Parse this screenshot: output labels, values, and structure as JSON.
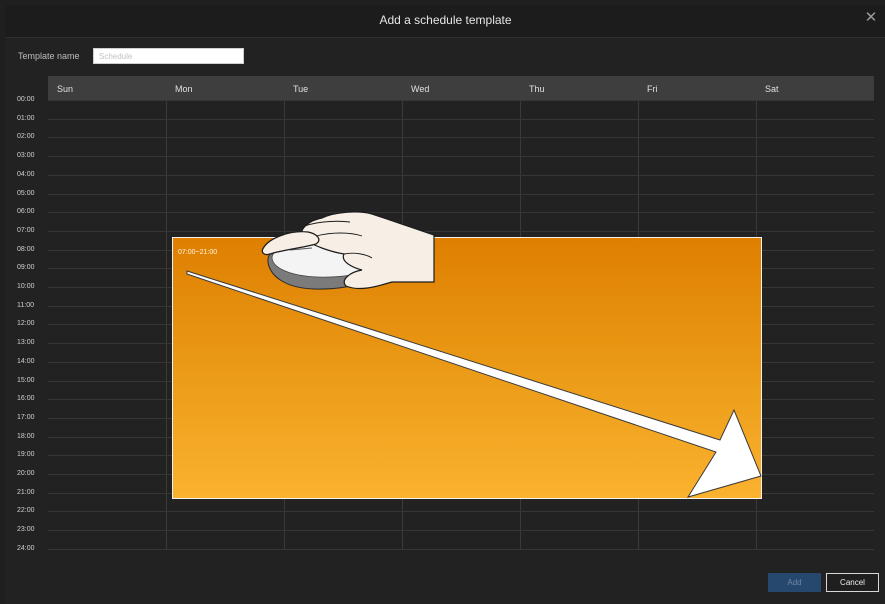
{
  "dialog": {
    "title": "Add a schedule template",
    "close_glyph": "✕",
    "close_icon": "close-icon"
  },
  "template": {
    "label": "Template name",
    "value": "",
    "placeholder": "Schedule"
  },
  "days": [
    "Sun",
    "Mon",
    "Tue",
    "Wed",
    "Thu",
    "Fri",
    "Sat"
  ],
  "hours": [
    "00:00",
    "01:00",
    "02:00",
    "03:00",
    "04:00",
    "05:00",
    "06:00",
    "07:00",
    "08:00",
    "09:00",
    "10:00",
    "11:00",
    "12:00",
    "13:00",
    "14:00",
    "15:00",
    "16:00",
    "17:00",
    "18:00",
    "19:00",
    "20:00",
    "21:00",
    "22:00",
    "23:00",
    "24:00"
  ],
  "selection": {
    "label": "07:00~21:00",
    "color": "#ec9411",
    "illustration_icons": [
      "hand-mouse-icon",
      "drag-arrow-icon"
    ]
  },
  "buttons": {
    "add": "Add",
    "cancel": "Cancel"
  }
}
